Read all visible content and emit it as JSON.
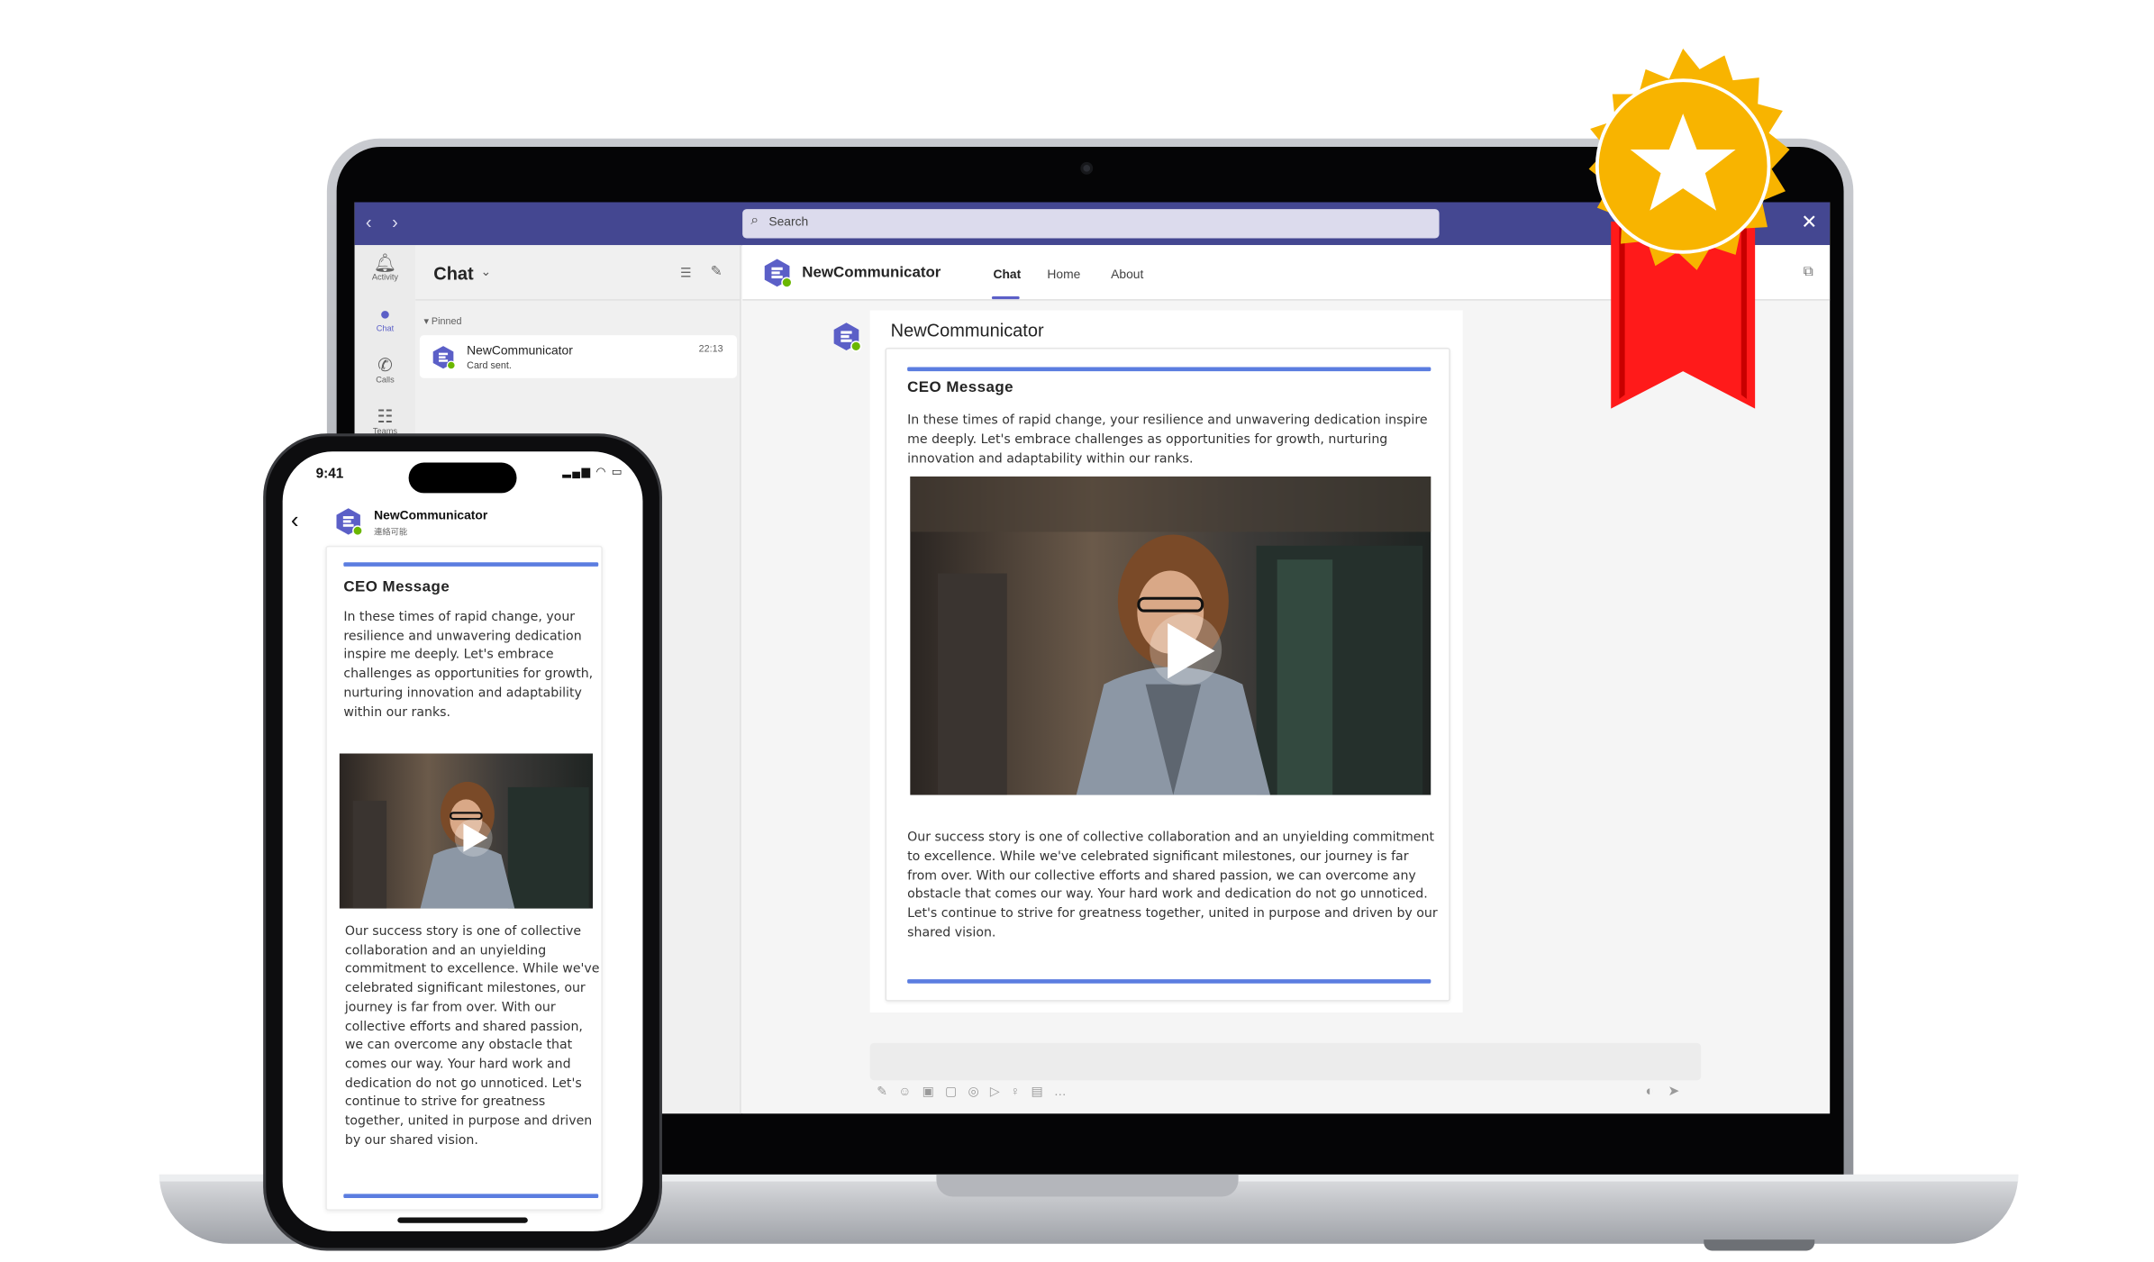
{
  "teams": {
    "search_placeholder": "Search",
    "rail": [
      {
        "label": "Activity",
        "icon": "bell-icon"
      },
      {
        "label": "Chat",
        "icon": "chat-icon"
      },
      {
        "label": "Calls",
        "icon": "phone-icon"
      },
      {
        "label": "Teams",
        "icon": "teams-icon"
      }
    ],
    "chat_list": {
      "title": "Chat",
      "pinned_label": "Pinned",
      "row": {
        "name": "NewCommunicator",
        "time": "22:13",
        "preview": "Card sent."
      }
    },
    "header": {
      "app_name": "NewCommunicator",
      "tabs": [
        "Chat",
        "Home",
        "About"
      ],
      "active_tab": "Chat"
    },
    "message": {
      "sender": "NewCommunicator"
    }
  },
  "card": {
    "title": "CEO Message",
    "body1": "In these times of rapid change, your resilience and unwavering dedication inspire me deeply. Let's embrace challenges as opportunities for growth, nurturing innovation and adaptability within our ranks.",
    "body2": "Our success story is one of collective collaboration and an unyielding commitment to excellence. While we've celebrated significant milestones, our journey is far from over. With our collective efforts and shared passion, we can overcome any obstacle that comes our way. Your hard work and dedication do not go unnoticed. Let's continue to strive for greatness together, united in purpose and driven by our shared vision."
  },
  "phone": {
    "time": "9:41",
    "app_name": "NewCommunicator",
    "status_text": "連絡可能"
  },
  "colors": {
    "teams_purple": "#444791",
    "accent": "#5b5fc7",
    "card_rule": "#5b7de0",
    "award_gold": "#f8b400",
    "award_ribbon": "#ff1a1a"
  }
}
